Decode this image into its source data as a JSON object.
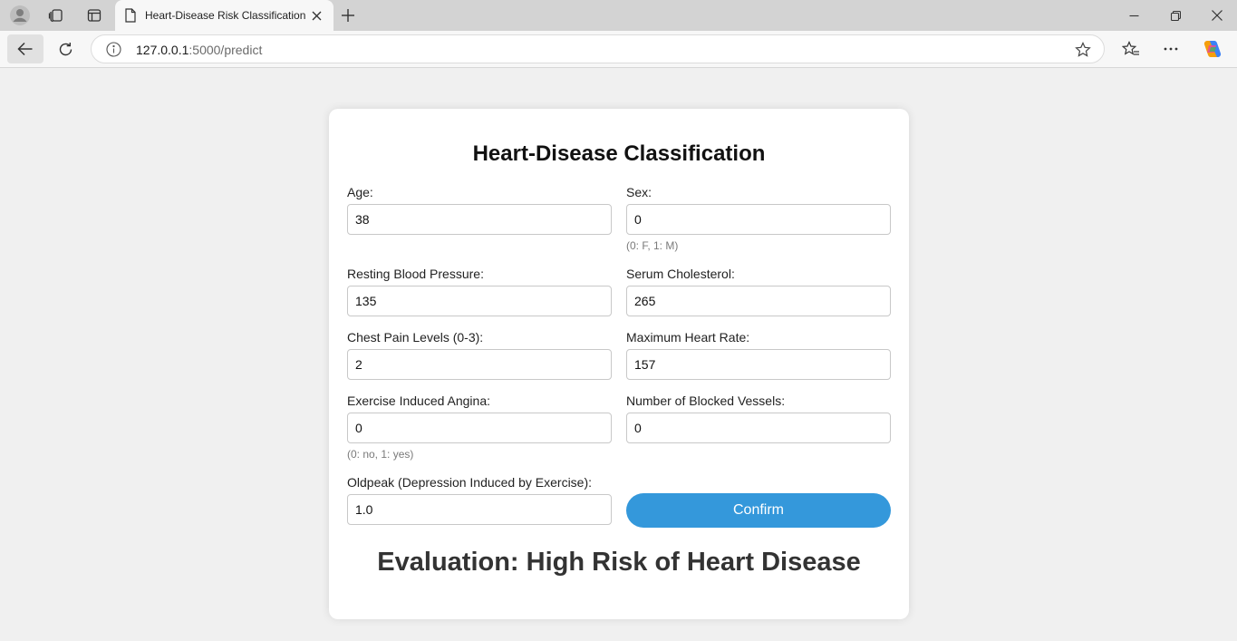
{
  "browser": {
    "tab_title": "Heart-Disease Risk Classification",
    "url_host": "127.0.0.1",
    "url_path": ":5000/predict"
  },
  "form": {
    "title": "Heart-Disease Classification",
    "fields": {
      "age": {
        "label": "Age:",
        "value": "38"
      },
      "sex": {
        "label": "Sex:",
        "value": "0",
        "hint": "(0: F, 1: M)"
      },
      "bp": {
        "label": "Resting Blood Pressure:",
        "value": "135"
      },
      "chol": {
        "label": "Serum Cholesterol:",
        "value": "265"
      },
      "cp": {
        "label": "Chest Pain Levels (0-3):",
        "value": "2"
      },
      "hr": {
        "label": "Maximum Heart Rate:",
        "value": "157"
      },
      "angina": {
        "label": "Exercise Induced Angina:",
        "value": "0",
        "hint": "(0: no, 1: yes)"
      },
      "vessels": {
        "label": "Number of Blocked Vessels:",
        "value": "0"
      },
      "oldpeak": {
        "label": "Oldpeak (Depression Induced by Exercise):",
        "value": "1.0"
      }
    },
    "confirm_label": "Confirm",
    "result": "Evaluation: High Risk of Heart Disease"
  },
  "colors": {
    "accent": "#3498db",
    "page_bg": "#f0f0f0",
    "card_bg": "#ffffff"
  },
  "icons": [
    "profile-icon",
    "collections-icon",
    "tab-actions-icon",
    "document-icon",
    "close-icon",
    "plus-icon",
    "minimize-icon",
    "restore-icon",
    "window-close-icon",
    "back-arrow-icon",
    "reload-icon",
    "info-icon",
    "favorite-star-icon",
    "favorites-icon",
    "more-icon",
    "copilot-icon"
  ]
}
